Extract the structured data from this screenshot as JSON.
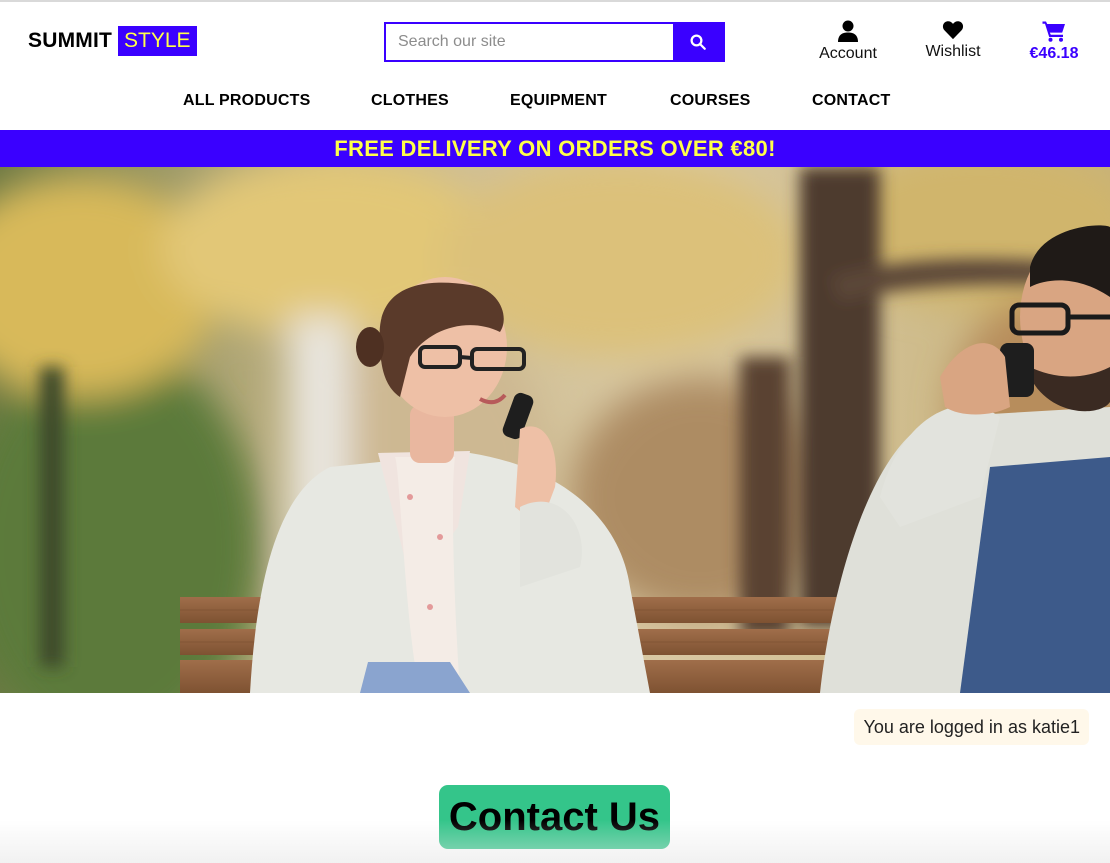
{
  "header": {
    "logo": {
      "part1": "SUMMIT",
      "part2": "STYLE"
    },
    "search": {
      "placeholder": "Search our site",
      "value": "",
      "icon": "search-icon"
    },
    "account": {
      "label": "Account",
      "icon": "user-icon"
    },
    "wishlist": {
      "label": "Wishlist",
      "icon": "heart-icon"
    },
    "cart": {
      "total": "€46.18",
      "icon": "cart-icon"
    }
  },
  "nav": {
    "items": [
      {
        "label": "ALL PRODUCTS"
      },
      {
        "label": "CLOTHES"
      },
      {
        "label": "EQUIPMENT"
      },
      {
        "label": "COURSES"
      },
      {
        "label": "CONTACT"
      }
    ]
  },
  "promo": {
    "text": "FREE DELIVERY ON ORDERS OVER €80!"
  },
  "status": {
    "logged_in": "You are logged in as katie1"
  },
  "main": {
    "heading": "Contact Us"
  },
  "colors": {
    "brand": "#3a00ff",
    "brand_text": "#ffff4a",
    "heading_bg": "#34c58a",
    "status_bg": "#fff8ea"
  }
}
